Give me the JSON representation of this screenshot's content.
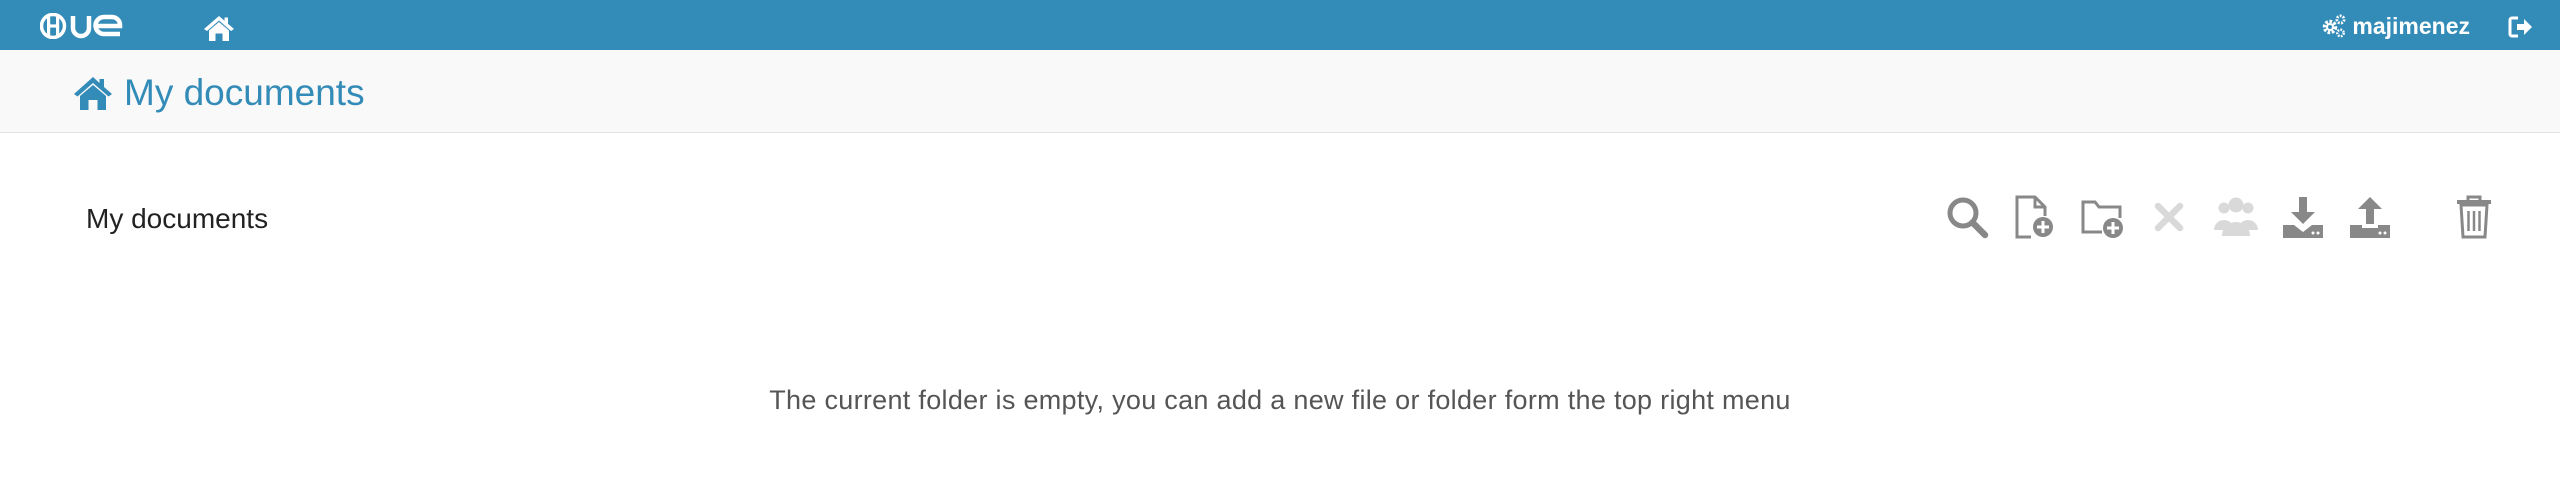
{
  "topbar": {
    "logo_alt": "Hue",
    "username": "majimenez"
  },
  "header": {
    "title": "My documents"
  },
  "content": {
    "folder_title": "My documents",
    "empty_message": "The current folder is empty, you can add a new file or folder form the top right menu"
  },
  "toolbar": {
    "icons": [
      "search-icon",
      "new-document-icon",
      "new-folder-icon",
      "delete-icon",
      "share-icon",
      "download-icon",
      "upload-icon",
      "trash-icon"
    ]
  },
  "colors": {
    "brand": "#338bb8",
    "icon_active": "#888888",
    "icon_disabled": "#d9d9d9"
  }
}
